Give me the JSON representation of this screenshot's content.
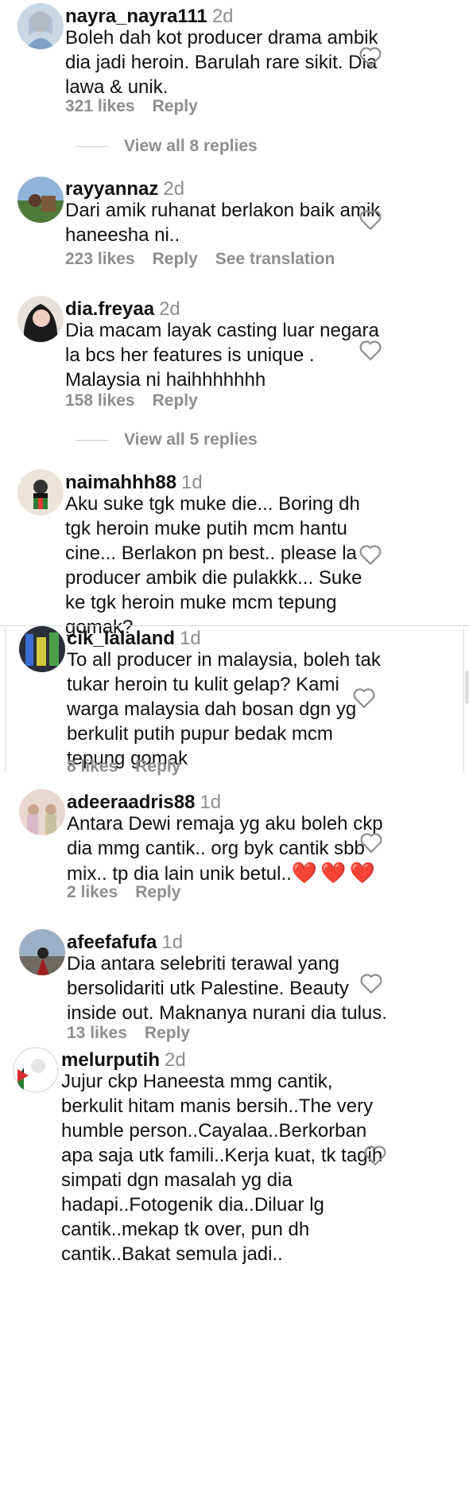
{
  "comments": [
    {
      "username": "nayra_nayra111",
      "time": "2d",
      "text": "Boleh dah kot producer drama ambik\ndia jadi heroin. Barulah rare sikit. Dia\nlawa & unik.",
      "likes": "321 likes",
      "reply": "Reply",
      "view_replies": "View all 8 replies"
    },
    {
      "username": "rayyannaz",
      "time": "2d",
      "text": "Dari amik ruhanat berlakon baik amik\nhaneesha ni..",
      "likes": "223 likes",
      "reply": "Reply",
      "see_translation": "See translation"
    },
    {
      "username": "dia.freyaa",
      "time": "2d",
      "text": "Dia macam layak casting luar negara\nla bcs her features is unique .\nMalaysia ni haihhhhhhh",
      "likes": "158 likes",
      "reply": "Reply",
      "view_replies": "View all 5 replies"
    },
    {
      "username": "naimahhh88",
      "time": "1d",
      "text": "Aku suke tgk muke die... Boring dh\ntgk heroin muke putih mcm hantu\ncine... Berlakon pn best.. please la\nproducer ambik die pulakkk... Suke\nke tgk heroin muke mcm tepung\ngomak?"
    },
    {
      "username": "cik_lalaland",
      "time": "1d",
      "text": "To all producer in malaysia, boleh tak\ntukar heroin tu kulit gelap? Kami\nwarga malaysia dah bosan dgn yg\nberkulit putih pupur bedak mcm\ntepung gomak",
      "likes": "8 likes",
      "reply": "Reply"
    },
    {
      "username": "adeeraadris88",
      "time": "1d",
      "text": "Antara Dewi remaja yg aku boleh ckp\ndia mmg cantik.. org byk cantik sbb\nmix.. tp dia lain unik betul..",
      "emoji": "❤️❤️❤️",
      "likes": "2 likes",
      "reply": "Reply"
    },
    {
      "username": "afeefafufa",
      "time": "1d",
      "text": "Dia antara selebriti terawal yang\nbersolidariti utk Palestine. Beauty\ninside out. Maknanya nurani dia tulus.",
      "likes": "13 likes",
      "reply": "Reply"
    },
    {
      "username": "melurputih",
      "time": "2d",
      "text": "Jujur ckp Haneesta mmg cantik,\nberkulit hitam manis bersih..The very\nhumble person..Cayalaa..Berkorban\napa saja utk famili..Kerja kuat, tk tagih\nsimpati dgn masalah yg dia\nhadapi..Fotogenik dia..Diluar lg\ncantik..mekap tk over, pun dh\ncantik..Bakat semula jadi.."
    }
  ],
  "colors": {
    "text": "#111111",
    "meta": "#8e8e8e",
    "heart_stroke": "#8e8e8e",
    "emoji": "#e02020"
  },
  "icons": {
    "like": "heart-outline-icon"
  }
}
